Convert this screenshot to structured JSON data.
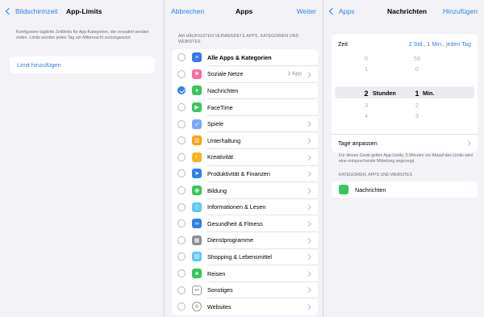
{
  "pane1": {
    "back_label": "Bildschirmzeit",
    "title": "App-Limits",
    "description": "Konfiguriere tägliche Zeitlimits für App-Kategorien, die verwaltet werden sollen. Limits werden jeden Tag um Mitternacht zurückgesetzt.",
    "add_limit_label": "Limit hinzufügen"
  },
  "pane2": {
    "cancel_label": "Abbrechen",
    "title": "Apps",
    "next_label": "Weiter",
    "section_header": "AM HÄUFIGSTEN VERWENDETE APPS, KATEGORIEN UND WEBSITES",
    "items": [
      {
        "label": "Alle Apps & Kategorien",
        "icon": "layers-icon",
        "color": "#3478f6",
        "detail": "",
        "chevron": false,
        "checked": false
      },
      {
        "label": "Soziale Netze",
        "icon": "social-icon",
        "color": "#ff6b9a",
        "detail": "1 App",
        "chevron": true,
        "checked": false
      },
      {
        "label": "Nachrichten",
        "icon": "messages-icon",
        "color": "#34c759",
        "detail": "",
        "chevron": false,
        "checked": true
      },
      {
        "label": "FaceTime",
        "icon": "facetime-icon",
        "color": "#34c759",
        "detail": "",
        "chevron": false,
        "checked": false
      },
      {
        "label": "Spiele",
        "icon": "rocket-icon",
        "color": "#7aa8ff",
        "detail": "",
        "chevron": true,
        "checked": false
      },
      {
        "label": "Unterhaltung",
        "icon": "popcorn-icon",
        "color": "#ff9f0a",
        "detail": "",
        "chevron": true,
        "checked": false
      },
      {
        "label": "Kreativität",
        "icon": "palette-icon",
        "color": "#ffb020",
        "detail": "",
        "chevron": true,
        "checked": false
      },
      {
        "label": "Produktivität & Finanzen",
        "icon": "paperplane-icon",
        "color": "#2f80ed",
        "detail": "",
        "chevron": true,
        "checked": false
      },
      {
        "label": "Bildung",
        "icon": "globe-icon",
        "color": "#34c759",
        "detail": "",
        "chevron": true,
        "checked": false
      },
      {
        "label": "Informationen & Lesen",
        "icon": "book-icon",
        "color": "#5ac8fa",
        "detail": "",
        "chevron": true,
        "checked": false
      },
      {
        "label": "Gesundheit & Fitness",
        "icon": "bicycle-icon",
        "color": "#2f80ed",
        "detail": "",
        "chevron": true,
        "checked": false
      },
      {
        "label": "Dienstprogramme",
        "icon": "calculator-icon",
        "color": "#8e8e93",
        "detail": "",
        "chevron": true,
        "checked": false
      },
      {
        "label": "Shopping & Lebensmittel",
        "icon": "shopping-icon",
        "color": "#5ac8fa",
        "detail": "",
        "chevron": true,
        "checked": false
      },
      {
        "label": "Reisen",
        "icon": "palm-tree-icon",
        "color": "#34c759",
        "detail": "",
        "chevron": true,
        "checked": false
      },
      {
        "label": "Sonstiges",
        "icon": "ellipsis-icon",
        "color": "#8e8e93",
        "detail": "",
        "chevron": true,
        "checked": false
      },
      {
        "label": "Websites",
        "icon": "compass-icon",
        "color": "#8e8e93",
        "detail": "",
        "chevron": true,
        "checked": false
      }
    ]
  },
  "pane3": {
    "back_label": "Apps",
    "title": "Nachrichten",
    "add_label": "Hinzufügen",
    "time_label": "Zeit",
    "time_value": "2 Std., 1 Min., jeden Tag",
    "hours_values": [
      "0",
      "1",
      "2",
      "3",
      "4"
    ],
    "minutes_values": [
      "59",
      "0",
      "1",
      "2",
      "3"
    ],
    "hours_unit": "Stunden",
    "minutes_unit": "Min.",
    "customize_days_label": "Tage anpassen",
    "footnote": "Für dieses Gerät gelten App-Limits. 5 Minuten vor Ablauf des Limits wird eine entsprechende Mitteilung angezeigt.",
    "category_header": "KATEGORIEN, APPS UND WEBSITES",
    "selected_app": "Nachrichten"
  }
}
